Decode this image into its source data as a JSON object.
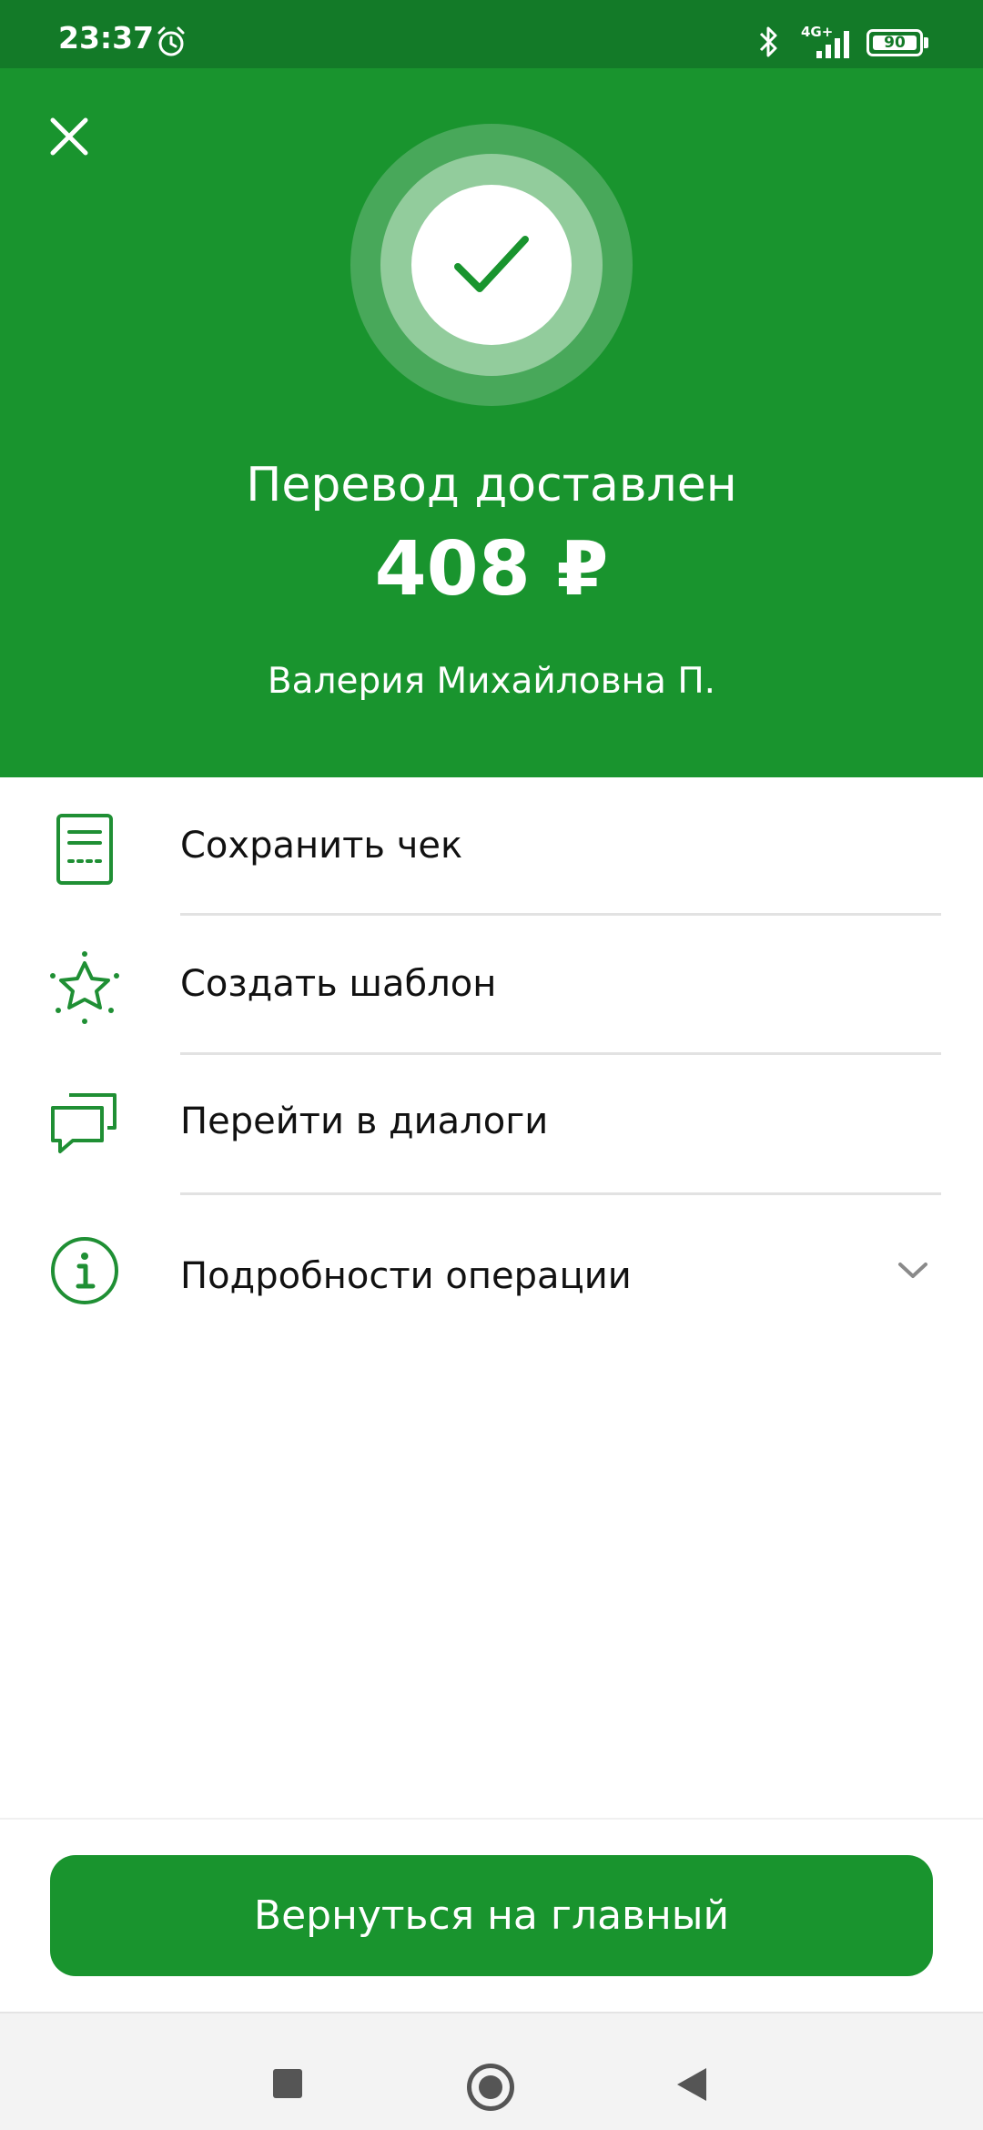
{
  "status_bar": {
    "time": "23:37",
    "network": "4G+",
    "battery": "90",
    "icons": [
      "alarm-icon",
      "bluetooth-icon",
      "signal-icon",
      "battery-icon"
    ]
  },
  "header": {
    "close_icon": "close-icon",
    "success_icon": "check-icon",
    "title": "Перевод доставлен",
    "amount": "408 ₽",
    "recipient": "Валерия Михайловна П."
  },
  "actions": [
    {
      "label": "Сохранить чек",
      "icon": "receipt-icon"
    },
    {
      "label": "Создать шаблон",
      "icon": "star-icon"
    },
    {
      "label": "Перейти в диалоги",
      "icon": "chat-icon"
    },
    {
      "label": "Подробности операции",
      "icon": "info-icon",
      "expand_icon": "chevron-down-icon"
    }
  ],
  "main_button": {
    "label": "Вернуться на главный"
  },
  "nav_bar": {
    "icons": [
      "recents-icon",
      "home-icon",
      "back-icon"
    ]
  },
  "colors": {
    "brand_green": "#19942e",
    "status_bar_green": "#137a28",
    "ring_outer": "#48a85a",
    "ring_mid": "#92cc9c",
    "icon_green": "#1f8f34"
  }
}
